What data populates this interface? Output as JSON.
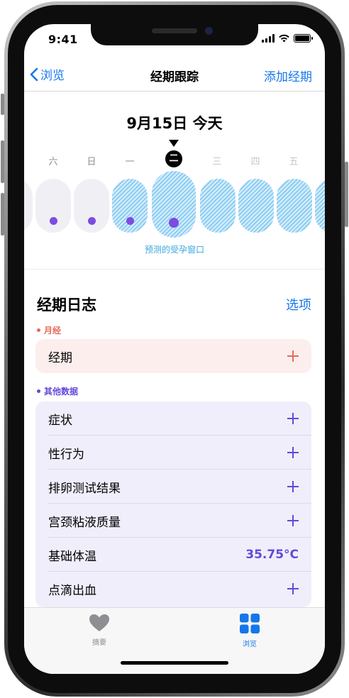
{
  "status": {
    "time": "9:41",
    "battery_level": 1.0
  },
  "nav": {
    "back_label": "浏览",
    "title": "经期跟踪",
    "action_label": "添加经期"
  },
  "calendar": {
    "heading": "9月15日 今天",
    "weekdays": [
      {
        "label": "六",
        "muted": false,
        "today": false
      },
      {
        "label": "日",
        "muted": false,
        "today": false
      },
      {
        "label": "一",
        "muted": false,
        "today": false
      },
      {
        "label": "二",
        "muted": false,
        "today": true
      },
      {
        "label": "三",
        "muted": true,
        "today": false
      },
      {
        "label": "四",
        "muted": true,
        "today": false
      },
      {
        "label": "五",
        "muted": true,
        "today": false
      }
    ],
    "fertile_window_label": "预测的受孕窗口",
    "colors": {
      "fertile_stripe": "#8ccdf2",
      "log_dot": "#7d4ce0",
      "day_pill": "#f0eff3"
    }
  },
  "log": {
    "title": "经期日志",
    "options_label": "选项",
    "period": {
      "category_label": "月经",
      "color": "#e8685a",
      "rows": [
        {
          "label": "经期"
        }
      ]
    },
    "other": {
      "category_label": "其他数据",
      "color": "#6448d8",
      "rows": [
        {
          "label": "症状"
        },
        {
          "label": "性行为"
        },
        {
          "label": "排卵测试结果"
        },
        {
          "label": "宫颈粘液质量"
        },
        {
          "label": "基础体温",
          "value": "35.75°C"
        },
        {
          "label": "点滴出血"
        }
      ]
    }
  },
  "tabbar": {
    "items": [
      {
        "label": "摘要",
        "icon": "heart-icon",
        "active": false
      },
      {
        "label": "浏览",
        "icon": "grid-icon",
        "active": true
      }
    ],
    "colors": {
      "active": "#1677ea",
      "inactive": "#8e8e93"
    }
  }
}
